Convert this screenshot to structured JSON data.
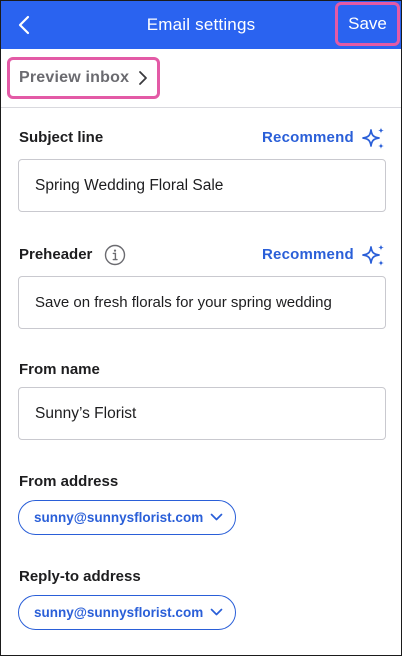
{
  "header": {
    "title": "Email settings",
    "save_label": "Save",
    "bg_color": "#2a63f0"
  },
  "preview": {
    "label": "Preview inbox"
  },
  "subject": {
    "label": "Subject line",
    "recommend_label": "Recommend",
    "value": "Spring Wedding Floral Sale"
  },
  "preheader": {
    "label": "Preheader",
    "recommend_label": "Recommend",
    "value": "Save on fresh florals for your spring wedding"
  },
  "from_name": {
    "label": "From name",
    "value": "Sunny’s Florist"
  },
  "from_address": {
    "label": "From address",
    "selected": "sunny@sunnysflorist.com"
  },
  "reply_to": {
    "label": "Reply-to address",
    "selected": "sunny@sunnysflorist.com"
  },
  "colors": {
    "accent": "#2a5fd8",
    "highlight": "#e35aa6"
  },
  "icons": [
    "chevron-left-icon",
    "chevron-right-icon",
    "sparkle-icon",
    "info-icon",
    "chevron-down-icon"
  ]
}
